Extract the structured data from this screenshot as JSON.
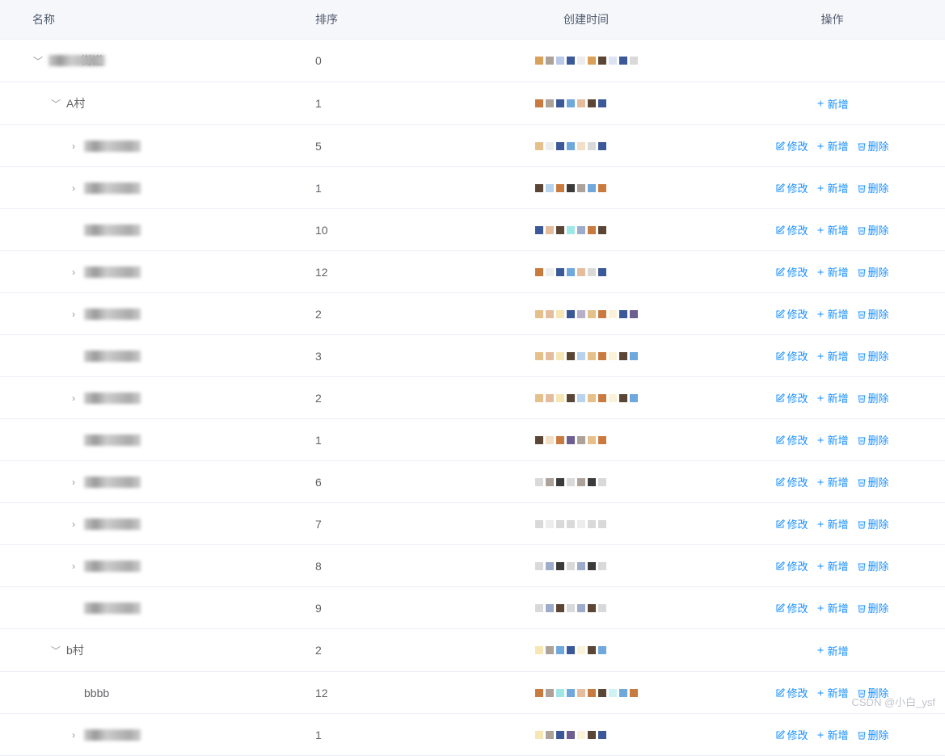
{
  "header": {
    "name": "名称",
    "sort": "排序",
    "createTime": "创建时间",
    "actions": "操作"
  },
  "actions": {
    "edit": "修改",
    "add": "新增",
    "delete": "删除"
  },
  "rows": [
    {
      "indent": 0,
      "expand": "down",
      "name_obscured": true,
      "name_suffix": "街道",
      "sort": "0",
      "actions": []
    },
    {
      "indent": 1,
      "expand": "down",
      "name_obscured": false,
      "name": "A村",
      "sort": "1",
      "actions": [
        "add"
      ]
    },
    {
      "indent": 2,
      "expand": "right",
      "name_obscured": true,
      "sort": "5",
      "actions": [
        "edit",
        "add",
        "delete"
      ]
    },
    {
      "indent": 2,
      "expand": "right",
      "name_obscured": true,
      "sort": "1",
      "actions": [
        "edit",
        "add",
        "delete"
      ]
    },
    {
      "indent": 2,
      "expand": "none",
      "name_obscured": true,
      "sort": "10",
      "actions": [
        "edit",
        "add",
        "delete"
      ]
    },
    {
      "indent": 2,
      "expand": "right",
      "name_obscured": true,
      "sort": "12",
      "actions": [
        "edit",
        "add",
        "delete"
      ]
    },
    {
      "indent": 2,
      "expand": "right",
      "name_obscured": true,
      "sort": "2",
      "actions": [
        "edit",
        "add",
        "delete"
      ]
    },
    {
      "indent": 2,
      "expand": "none",
      "name_obscured": true,
      "sort": "3",
      "actions": [
        "edit",
        "add",
        "delete"
      ]
    },
    {
      "indent": 2,
      "expand": "right",
      "name_obscured": true,
      "sort": "2",
      "actions": [
        "edit",
        "add",
        "delete"
      ]
    },
    {
      "indent": 2,
      "expand": "none",
      "name_obscured": true,
      "sort": "1",
      "actions": [
        "edit",
        "add",
        "delete"
      ]
    },
    {
      "indent": 2,
      "expand": "right",
      "name_obscured": true,
      "sort": "6",
      "actions": [
        "edit",
        "add",
        "delete"
      ]
    },
    {
      "indent": 2,
      "expand": "right",
      "name_obscured": true,
      "sort": "7",
      "actions": [
        "edit",
        "add",
        "delete"
      ]
    },
    {
      "indent": 2,
      "expand": "right",
      "name_obscured": true,
      "sort": "8",
      "actions": [
        "edit",
        "add",
        "delete"
      ]
    },
    {
      "indent": 2,
      "expand": "none",
      "name_obscured": true,
      "sort": "9",
      "actions": [
        "edit",
        "add",
        "delete"
      ]
    },
    {
      "indent": 1,
      "expand": "down",
      "name_obscured": false,
      "name": "b村",
      "sort": "2",
      "actions": [
        "add"
      ]
    },
    {
      "indent": 2,
      "expand": "none",
      "name_obscured": false,
      "name": "bbbb",
      "sort": "12",
      "actions": [
        "edit",
        "add",
        "delete"
      ]
    },
    {
      "indent": 2,
      "expand": "right",
      "name_obscured": true,
      "sort": "1",
      "actions": [
        "edit",
        "add",
        "delete"
      ]
    }
  ],
  "watermark": "CSDN @小白_ysf",
  "pixel_colors": [
    [
      "#D9A05A",
      "#5B4636",
      "#B9C8E8",
      "#3B5998",
      "#D9D9D9"
    ],
    [
      "#C97B3F",
      "#5B4636",
      "#3B5998",
      "#6FA8DC"
    ],
    [
      "#E6C08B",
      "#D9D9D9",
      "#3B5998",
      "#6FA8DC"
    ],
    [
      "#5B4636",
      "#6FA8DC",
      "#C97B3F",
      "#3B3B3B"
    ],
    [
      "#3B5998",
      "#C97B3F",
      "#5B4636",
      "#9FE6E6"
    ],
    [
      "#C97B3F",
      "#D9D9D9",
      "#3B5998",
      "#6FA8DC"
    ],
    [
      "#E6C08B",
      "#C97B3F",
      "#F5E6B3",
      "#3B5998",
      "#6D5F8F"
    ],
    [
      "#E6C08B",
      "#C97B3F",
      "#F5E6B3",
      "#5B4636",
      "#6FA8DC"
    ],
    [
      "#E6C08B",
      "#C97B3F",
      "#F5E6B3",
      "#5B4636",
      "#6FA8DC"
    ],
    [
      "#5B4636",
      "#E6C08B",
      "#C97B3F",
      "#6D5F8F"
    ],
    [
      "#D9D9D9",
      "#5B4636",
      "#3B3B3B"
    ],
    [
      "#D9D9D9",
      "#D9D9D9",
      "#D9D9D9"
    ],
    [
      "#D9D9D9",
      "#3B5998",
      "#3B3B3B"
    ],
    [
      "#D9D9D9",
      "#3B5998",
      "#5B4636"
    ],
    [
      "#F5E6B3",
      "#5B4636",
      "#6FA8DC",
      "#3B5998"
    ],
    [
      "#C97B3F",
      "#5B4636",
      "#9FE6E6",
      "#6FA8DC",
      "#C97B3F"
    ],
    [
      "#F5E6B3",
      "#5B4636",
      "#3B5998",
      "#6D5F8F"
    ]
  ]
}
